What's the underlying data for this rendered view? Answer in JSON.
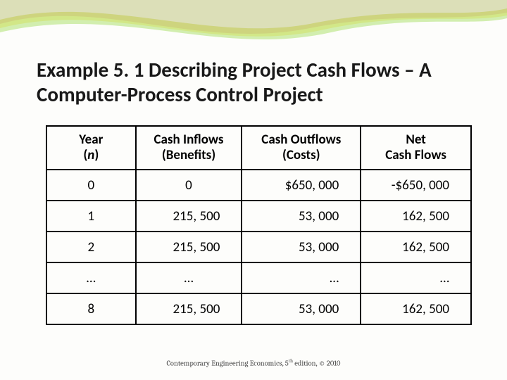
{
  "title": "Example 5. 1 Describing Project Cash Flows – A Computer-Process Control Project",
  "headers": {
    "year_top": "Year",
    "year_bottom_prefix": "(",
    "year_bottom_italic": "n",
    "year_bottom_suffix": ")",
    "inflows_top": "Cash Inflows",
    "inflows_bottom": "(Benefits)",
    "outflows_top": "Cash Outflows",
    "outflows_bottom": "(Costs)",
    "net_top": "Net",
    "net_bottom": "Cash Flows"
  },
  "rows": [
    {
      "year": "0",
      "inflows": "0",
      "outflows": "$650, 000",
      "net": "-$650, 000"
    },
    {
      "year": "1",
      "inflows": "215, 500",
      "outflows": "53, 000",
      "net": "162, 500"
    },
    {
      "year": "2",
      "inflows": "215, 500",
      "outflows": "53, 000",
      "net": "162, 500"
    },
    {
      "year": "…",
      "inflows": "…",
      "outflows": "…",
      "net": "…"
    },
    {
      "year": "8",
      "inflows": "215, 500",
      "outflows": "53, 000",
      "net": "162, 500"
    }
  ],
  "footer": {
    "text_a": "Contemporary Engineering Economics, 5",
    "sup": "th",
    "text_b": " edition, © 2010"
  },
  "chart_data": {
    "type": "table",
    "title": "Example 5.1 Describing Project Cash Flows – A Computer-Process Control Project",
    "columns": [
      "Year (n)",
      "Cash Inflows (Benefits)",
      "Cash Outflows (Costs)",
      "Net Cash Flows"
    ],
    "data": [
      [
        "0",
        0,
        650000,
        -650000
      ],
      [
        "1",
        215500,
        53000,
        162500
      ],
      [
        "2",
        215500,
        53000,
        162500
      ],
      [
        "…",
        "…",
        "…",
        "…"
      ],
      [
        "8",
        215500,
        53000,
        162500
      ]
    ]
  }
}
